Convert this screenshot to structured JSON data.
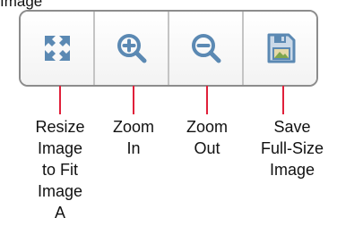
{
  "top_caption": "Image",
  "colors": {
    "icon_blue": "#5b89b3",
    "icon_light": "#cbd9e8",
    "callout_red": "#e0203a",
    "toolbar_border": "#8c8c8c"
  },
  "toolbar": {
    "buttons": [
      {
        "icon": "resize-fit-icon",
        "label": "Resize\nImage\nto Fit\nImage\nA"
      },
      {
        "icon": "zoom-in-icon",
        "label": "Zoom\nIn"
      },
      {
        "icon": "zoom-out-icon",
        "label": "Zoom\nOut"
      },
      {
        "icon": "save-image-icon",
        "label": "Save\nFull-Size\nImage"
      }
    ]
  }
}
